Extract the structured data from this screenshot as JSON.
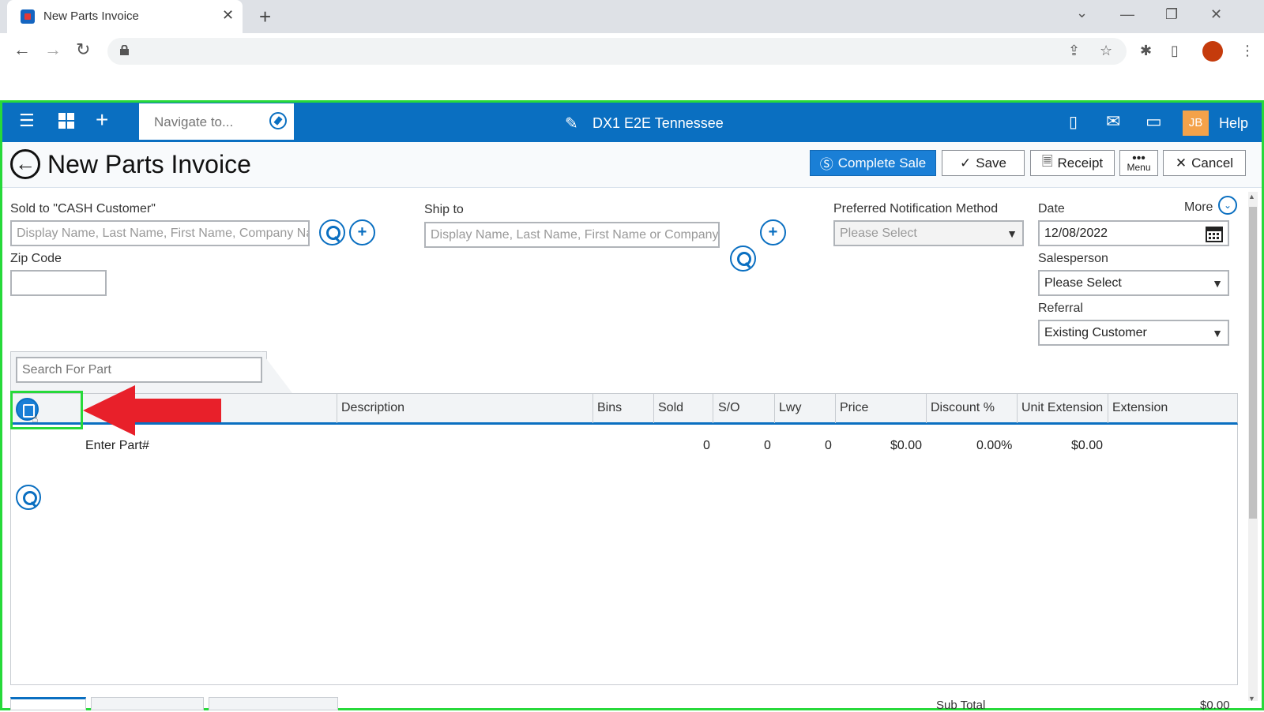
{
  "browser": {
    "tab_title": "New Parts Invoice",
    "tab_close": "✕",
    "new_tab": "+",
    "win_minimize": "—",
    "win_restore": "❐",
    "win_close": "✕",
    "tab_list": "⌄"
  },
  "header": {
    "nav_placeholder": "Navigate to...",
    "store_name": "DX1 E2E Tennessee",
    "user_initials": "JB",
    "help_label": "Help"
  },
  "title_bar": {
    "title": "New Parts Invoice",
    "complete_sale_label": "Complete Sale",
    "save_label": "Save",
    "receipt_label": "Receipt",
    "menu_label": "Menu",
    "cancel_label": "Cancel"
  },
  "form": {
    "sold_to_label": "Sold to  \"CASH Customer\"",
    "sold_to_placeholder": "Display Name, Last Name, First Name, Company Na",
    "zip_label": "Zip Code",
    "ship_to_label": "Ship to",
    "ship_to_placeholder": "Display Name, Last Name, First Name or Company",
    "notification_label": "Preferred Notification Method",
    "notification_value": "Please Select",
    "more_label": "More",
    "date_label": "Date",
    "date_value": "12/08/2022",
    "salesperson_label": "Salesperson",
    "salesperson_value": "Please Select",
    "referral_label": "Referral",
    "referral_value": "Existing Customer"
  },
  "grid": {
    "search_placeholder": "Search For Part",
    "columns": [
      "Description",
      "Bins",
      "Sold",
      "S/O",
      "Lwy",
      "Price",
      "Discount %",
      "Unit Extension",
      "Extension"
    ],
    "row": {
      "part": "Enter Part#",
      "sold": "0",
      "so": "0",
      "lwy": "0",
      "price": "$0.00",
      "discount": "0.00%",
      "unit_extension": "$0.00"
    }
  },
  "footer": {
    "subtotal_label": "Sub Total",
    "subtotal_value": "$0.00"
  },
  "colors": {
    "header_blue": "#0a6fc1",
    "highlight_green": "#27d93a",
    "arrow_red": "#e8202a",
    "badge_orange": "#f4a24a"
  }
}
